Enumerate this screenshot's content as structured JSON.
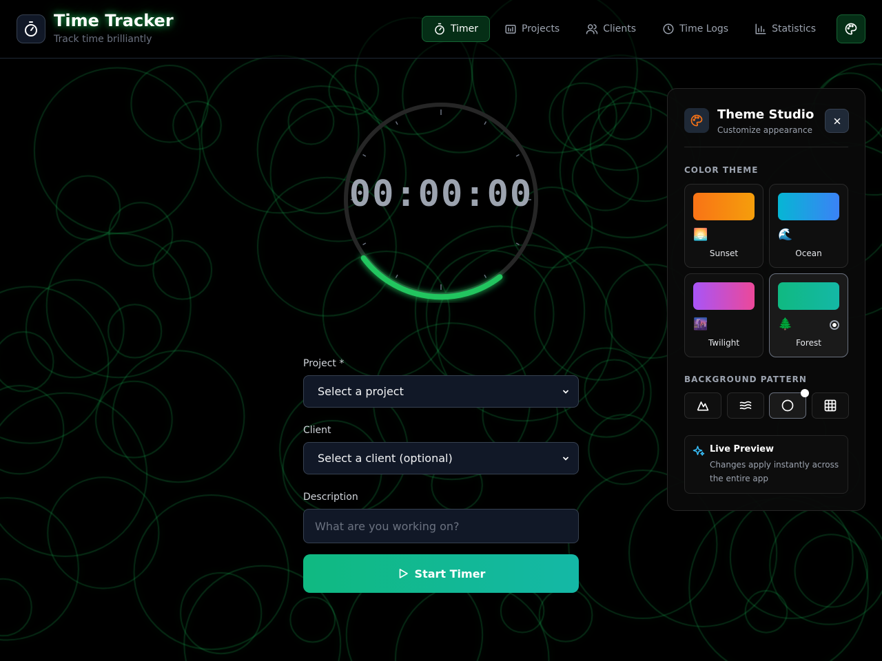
{
  "app": {
    "title": "Time Tracker",
    "subtitle": "Track time brilliantly",
    "logo_icon": "stopwatch-icon",
    "accent": "#22c55e"
  },
  "nav": {
    "items": [
      {
        "label": "Timer",
        "icon": "stopwatch-icon",
        "active": true
      },
      {
        "label": "Projects",
        "icon": "folder-chart-icon",
        "active": false
      },
      {
        "label": "Clients",
        "icon": "users-icon",
        "active": false
      },
      {
        "label": "Time Logs",
        "icon": "clock-icon",
        "active": false
      },
      {
        "label": "Statistics",
        "icon": "bar-chart-icon",
        "active": false
      }
    ],
    "theme_toggle_icon": "palette-icon"
  },
  "timer": {
    "display": "00:00:00"
  },
  "form": {
    "project_label": "Project *",
    "project_value": "Select a project",
    "client_label": "Client",
    "client_value": "Select a client (optional)",
    "description_label": "Description",
    "description_placeholder": "What are you working on?",
    "start_label": "Start Timer"
  },
  "theme_panel": {
    "title": "Theme Studio",
    "subtitle": "Customize appearance",
    "color_theme_heading": "COLOR THEME",
    "themes": [
      {
        "name": "Sunset",
        "emoji": "🌅",
        "from": "#f97316",
        "to": "#f59e0b",
        "selected": false
      },
      {
        "name": "Ocean",
        "emoji": "🌊",
        "from": "#06b6d4",
        "to": "#3b82f6",
        "selected": false
      },
      {
        "name": "Twilight",
        "emoji": "🌆",
        "from": "#a855f7",
        "to": "#ec4899",
        "selected": false
      },
      {
        "name": "Forest",
        "emoji": "🌲",
        "from": "#10b981",
        "to": "#14b8a6",
        "selected": true
      }
    ],
    "background_heading": "BACKGROUND PATTERN",
    "patterns": [
      {
        "icon": "mountain-icon",
        "selected": false
      },
      {
        "icon": "waves-icon",
        "selected": false
      },
      {
        "icon": "circle-icon",
        "selected": true
      },
      {
        "icon": "grid-icon",
        "selected": false
      }
    ],
    "preview_title": "Live Preview",
    "preview_text": "Changes apply instantly across the entire app"
  }
}
